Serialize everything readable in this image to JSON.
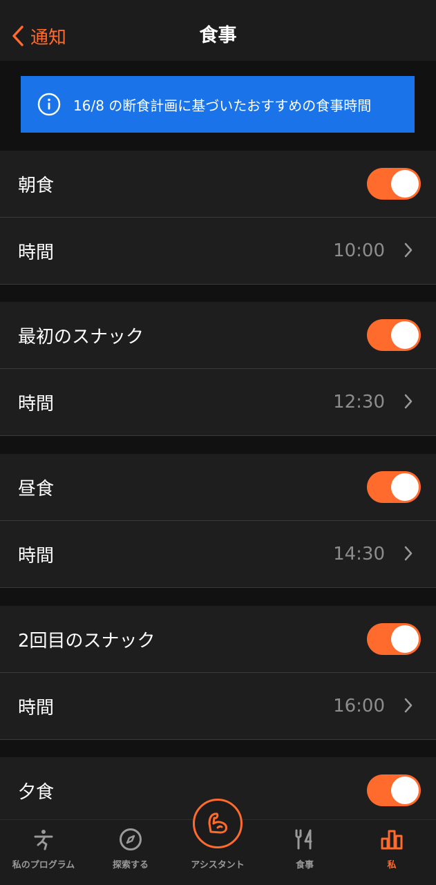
{
  "header": {
    "back_label": "通知",
    "title": "食事"
  },
  "banner": {
    "text": "16/8 の断食計画に基づいたおすすめの食事時間"
  },
  "meals": [
    {
      "name": "朝食",
      "enabled": true,
      "time_label": "時間",
      "time": "10:00"
    },
    {
      "name": "最初のスナック",
      "enabled": true,
      "time_label": "時間",
      "time": "12:30"
    },
    {
      "name": "昼食",
      "enabled": true,
      "time_label": "時間",
      "time": "14:30"
    },
    {
      "name": "2回目のスナック",
      "enabled": true,
      "time_label": "時間",
      "time": "16:00"
    },
    {
      "name": "夕食",
      "enabled": true
    }
  ],
  "tabbar": {
    "items": [
      {
        "label": "私のプログラム",
        "icon": "exercise-person-icon"
      },
      {
        "label": "探索する",
        "icon": "compass-icon"
      },
      {
        "label": "アシスタント",
        "icon": "flexed-arm-icon"
      },
      {
        "label": "食事",
        "icon": "fork-knife-icon"
      },
      {
        "label": "私",
        "icon": "bar-chart-icon"
      }
    ],
    "active": "私"
  },
  "colors": {
    "accent": "#ff6b2c",
    "banner": "#1a73e8",
    "background": "#111111",
    "row": "#1e1e1e"
  }
}
